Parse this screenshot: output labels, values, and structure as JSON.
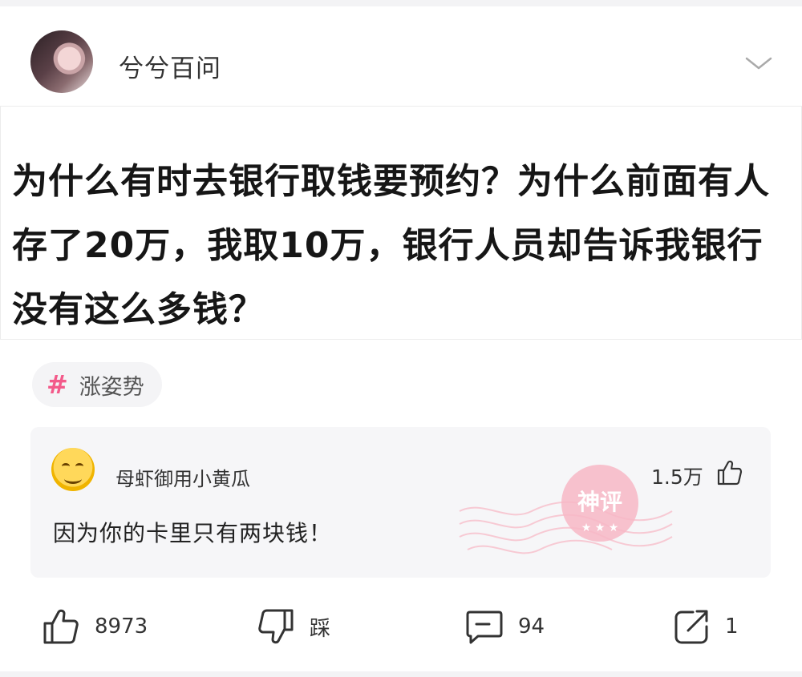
{
  "author": {
    "name": "兮兮百问"
  },
  "question": {
    "text": "为什么有时去银行取钱要预约？为什么前面有人存了20万，我取10万，银行人员却告诉我银行没有这么多钱？"
  },
  "tag": {
    "label": "涨姿势",
    "hash_symbol": "#",
    "color": "#f35a8a"
  },
  "comment": {
    "username": "母虾御用小黄瓜",
    "likes": "1.5万",
    "text": "因为你的卡里只有两块钱！",
    "badge_text": "神评"
  },
  "actions": {
    "like_count": "8973",
    "dislike_label": "踩",
    "comment_count": "94",
    "share_count": "1"
  },
  "icons": [
    "avatar",
    "chevron-down-icon",
    "thumbs-up-icon",
    "thumbs-down-icon",
    "comment-icon",
    "share-icon",
    "god-comment-stamp"
  ],
  "colors": {
    "accent": "#f35a8a",
    "stamp": "#f5a7b8",
    "card_bg": "#f6f6f8"
  }
}
